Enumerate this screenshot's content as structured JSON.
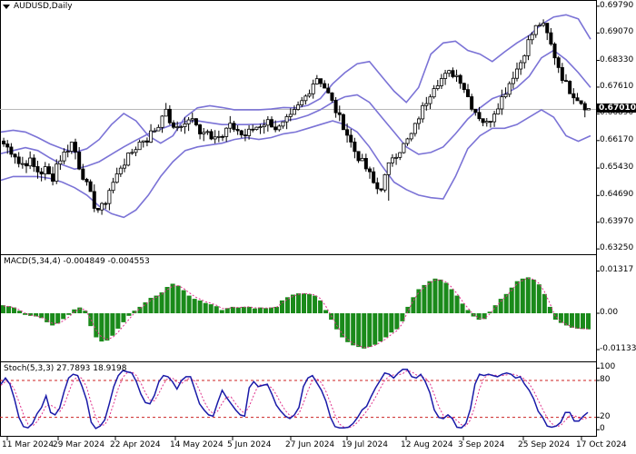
{
  "chart_data": [
    {
      "type": "candlestick",
      "title": "AUDUSD,Daily",
      "y_ticks": [
        "0.69790",
        "0.69070",
        "0.68330",
        "0.67610",
        "0.66890",
        "0.66170",
        "0.65430",
        "0.64690",
        "0.63970",
        "0.63250"
      ],
      "ylim": [
        0.6318,
        0.6986
      ],
      "current_price": 0.6701,
      "current_price_label": "0.67010",
      "x_ticks": [
        "11 Mar 2024",
        "29 Mar 2024",
        "22 Apr 2024",
        "14 May 2024",
        "5 Jun 2024",
        "27 Jun 2024",
        "19 Jul 2024",
        "12 Aug 2024",
        "3 Sep 2024",
        "25 Sep 2024",
        "17 Oct 2024"
      ],
      "overlay": "Bollinger Bands",
      "close_path": [
        0.6608,
        0.6594,
        0.6583,
        0.6551,
        0.6558,
        0.6561,
        0.6537,
        0.6531,
        0.6542,
        0.6506,
        0.6557,
        0.6575,
        0.6595,
        0.6616,
        0.6555,
        0.652,
        0.648,
        0.6444,
        0.6427,
        0.6448,
        0.649,
        0.6513,
        0.6548,
        0.6563,
        0.6584,
        0.6602,
        0.662,
        0.6621,
        0.6644,
        0.6651,
        0.6703,
        0.668,
        0.6641,
        0.6662,
        0.6658,
        0.668,
        0.6659,
        0.6642,
        0.6648,
        0.6631,
        0.664,
        0.6618,
        0.6651,
        0.6654,
        0.6645,
        0.6627,
        0.6638,
        0.665,
        0.6658,
        0.6665,
        0.6669,
        0.6652,
        0.6649,
        0.6668,
        0.6678,
        0.67,
        0.672,
        0.674,
        0.677,
        0.6789,
        0.677,
        0.6742,
        0.6712,
        0.668,
        0.6655,
        0.662,
        0.6589,
        0.6566,
        0.6545,
        0.652,
        0.6486,
        0.6493,
        0.653,
        0.6575,
        0.6585,
        0.66,
        0.6618,
        0.664,
        0.668,
        0.671,
        0.674,
        0.677,
        0.678,
        0.679,
        0.68,
        0.6795,
        0.678,
        0.6745,
        0.6712,
        0.669,
        0.6672,
        0.666,
        0.669,
        0.6715,
        0.674,
        0.677,
        0.68,
        0.682,
        0.686,
        0.6895,
        0.692,
        0.6935,
        0.691,
        0.687,
        0.683,
        0.679,
        0.676,
        0.6745,
        0.673,
        0.6715,
        0.6701
      ],
      "bollinger_upper": [
        0.664,
        0.6645,
        0.664,
        0.6625,
        0.6608,
        0.6595,
        0.6585,
        0.6595,
        0.662,
        0.666,
        0.669,
        0.667,
        0.663,
        0.661,
        0.663,
        0.668,
        0.6705,
        0.6711,
        0.6706,
        0.67,
        0.67,
        0.67,
        0.6702,
        0.6706,
        0.6705,
        0.6712,
        0.673,
        0.677,
        0.68,
        0.6824,
        0.683,
        0.679,
        0.675,
        0.672,
        0.676,
        0.685,
        0.688,
        0.6885,
        0.686,
        0.685,
        0.683,
        0.6856,
        0.688,
        0.69,
        0.693,
        0.695,
        0.6956,
        0.6945,
        0.689
      ],
      "bollinger_mid": [
        0.6582,
        0.659,
        0.6598,
        0.659,
        0.657,
        0.6552,
        0.654,
        0.6548,
        0.656,
        0.658,
        0.66,
        0.6618,
        0.6635,
        0.6648,
        0.666,
        0.6668,
        0.667,
        0.6665,
        0.666,
        0.666,
        0.666,
        0.6661,
        0.6665,
        0.667,
        0.6675,
        0.6685,
        0.67,
        0.672,
        0.6735,
        0.674,
        0.672,
        0.668,
        0.664,
        0.66,
        0.658,
        0.6585,
        0.66,
        0.6635,
        0.6675,
        0.6705,
        0.673,
        0.6742,
        0.676,
        0.679,
        0.684,
        0.686,
        0.6835,
        0.68,
        0.676
      ],
      "bollinger_lower": [
        0.651,
        0.652,
        0.652,
        0.652,
        0.6515,
        0.6505,
        0.649,
        0.647,
        0.644,
        0.642,
        0.641,
        0.643,
        0.647,
        0.652,
        0.656,
        0.659,
        0.66,
        0.6605,
        0.661,
        0.662,
        0.6625,
        0.662,
        0.6625,
        0.6635,
        0.664,
        0.665,
        0.666,
        0.667,
        0.666,
        0.664,
        0.66,
        0.655,
        0.6505,
        0.6485,
        0.647,
        0.6463,
        0.646,
        0.652,
        0.6595,
        0.663,
        0.665,
        0.665,
        0.666,
        0.668,
        0.67,
        0.668,
        0.663,
        0.6615,
        0.663
      ]
    },
    {
      "type": "bar",
      "title": "MACD(5,34,4) -0.004849 -0.004553",
      "y_ticks": [
        "0.01317",
        "0.00",
        "-0.01133"
      ],
      "ylim": [
        -0.0133,
        0.015
      ],
      "histogram": [
        0.0025,
        0.0022,
        0.0018,
        0.0008,
        -0.0005,
        -0.0008,
        -0.001,
        -0.0015,
        -0.0028,
        -0.0038,
        -0.0032,
        -0.0018,
        -0.0005,
        0.0012,
        0.0018,
        0.0008,
        -0.004,
        -0.0075,
        -0.0088,
        -0.0085,
        -0.007,
        -0.0048,
        -0.0028,
        -0.0008,
        0.0008,
        0.002,
        0.0034,
        0.0048,
        0.0055,
        0.0065,
        0.0082,
        0.0092,
        0.0086,
        0.0072,
        0.0055,
        0.0045,
        0.004,
        0.0032,
        0.0028,
        0.0022,
        0.001,
        0.0016,
        0.002,
        0.0018,
        0.002,
        0.002,
        0.0015,
        0.0018,
        0.0016,
        0.0018,
        0.002,
        0.004,
        0.005,
        0.0058,
        0.0062,
        0.0062,
        0.006,
        0.0055,
        0.004,
        0.001,
        -0.002,
        -0.005,
        -0.0075,
        -0.009,
        -0.01,
        -0.0105,
        -0.011,
        -0.0105,
        -0.0098,
        -0.0088,
        -0.0075,
        -0.006,
        -0.005,
        -0.0025,
        0.002,
        0.005,
        0.0075,
        0.0088,
        0.01,
        0.0108,
        0.0105,
        0.0095,
        0.0075,
        0.0055,
        0.003,
        0.001,
        -0.001,
        -0.002,
        -0.0018,
        0.0005,
        0.0025,
        0.0045,
        0.006,
        0.008,
        0.01,
        0.0108,
        0.0112,
        0.0105,
        0.009,
        0.006,
        0.002,
        -0.002,
        -0.003,
        -0.0038,
        -0.0045,
        -0.0048,
        -0.0049,
        -0.005
      ],
      "signal": [
        0.0023,
        0.0021,
        0.0017,
        0.001,
        0.0,
        -0.0006,
        -0.0009,
        -0.0013,
        -0.0022,
        -0.0032,
        -0.0032,
        -0.0023,
        -0.0011,
        0.0005,
        0.0014,
        0.0011,
        -0.002,
        -0.0055,
        -0.0075,
        -0.0081,
        -0.0075,
        -0.0058,
        -0.0038,
        -0.0018,
        0.0002,
        0.0015,
        0.0028,
        0.0041,
        0.005,
        0.006,
        0.0074,
        0.0085,
        0.0086,
        0.0077,
        0.0064,
        0.0052,
        0.0044,
        0.0036,
        0.0031,
        0.0025,
        0.0015,
        0.0015,
        0.0018,
        0.0018,
        0.0019,
        0.002,
        0.0017,
        0.0017,
        0.0016,
        0.0017,
        0.0019,
        0.0032,
        0.0044,
        0.0053,
        0.0059,
        0.0061,
        0.006,
        0.0057,
        0.0046,
        0.0022,
        -0.0008,
        -0.0038,
        -0.0063,
        -0.0081,
        -0.0094,
        -0.0101,
        -0.0107,
        -0.0105,
        -0.01,
        -0.0091,
        -0.008,
        -0.0066,
        -0.0055,
        -0.0033,
        0.0005,
        0.0038,
        0.0064,
        0.008,
        0.0094,
        0.0103,
        0.0104,
        0.0098,
        0.0082,
        0.0062,
        0.0038,
        0.0017,
        -0.0003,
        -0.0015,
        -0.0017,
        -0.0003,
        0.0017,
        0.0036,
        0.0052,
        0.0071,
        0.0091,
        0.0102,
        0.0109,
        0.0106,
        0.0094,
        0.0069,
        0.0033,
        -0.0008,
        -0.0024,
        -0.0034,
        -0.0042,
        -0.0046,
        -0.0048,
        -0.0049
      ]
    },
    {
      "type": "line",
      "title": "Stoch(5,3,3) 27.7893 18.9198",
      "y_ticks": [
        "100",
        "80",
        "20",
        "0"
      ],
      "ylim": [
        -10,
        108
      ],
      "levels": [
        80,
        20
      ],
      "k_line": [
        74,
        84,
        74,
        50,
        20,
        5,
        3,
        10,
        26,
        36,
        55,
        28,
        24,
        35,
        62,
        84,
        90,
        88,
        70,
        48,
        12,
        2,
        6,
        16,
        42,
        70,
        88,
        96,
        94,
        92,
        78,
        58,
        44,
        42,
        56,
        78,
        88,
        86,
        78,
        66,
        80,
        86,
        86,
        64,
        42,
        32,
        24,
        22,
        44,
        64,
        52,
        42,
        32,
        24,
        22,
        68,
        78,
        70,
        72,
        74,
        58,
        40,
        30,
        22,
        18,
        24,
        36,
        70,
        84,
        88,
        76,
        64,
        46,
        20,
        5,
        3,
        3,
        4,
        10,
        20,
        32,
        38,
        54,
        68,
        80,
        92,
        90,
        84,
        92,
        98,
        98,
        86,
        84,
        90,
        78,
        60,
        32,
        20,
        18,
        24,
        18,
        4,
        3,
        10,
        34,
        74,
        90,
        88,
        90,
        88,
        86,
        90,
        92,
        90,
        84,
        86,
        74,
        64,
        50,
        30,
        20,
        6,
        4,
        6,
        12,
        28,
        28,
        14,
        14,
        22,
        28
      ],
      "d_line": [
        72,
        78,
        77,
        65,
        45,
        25,
        9,
        6,
        13,
        24,
        39,
        40,
        36,
        29,
        40,
        60,
        79,
        87,
        83,
        69,
        43,
        21,
        7,
        8,
        21,
        43,
        67,
        85,
        93,
        94,
        88,
        76,
        60,
        48,
        47,
        59,
        74,
        84,
        84,
        77,
        75,
        81,
        84,
        79,
        64,
        46,
        33,
        26,
        30,
        43,
        53,
        53,
        42,
        33,
        26,
        38,
        56,
        72,
        73,
        72,
        68,
        57,
        43,
        31,
        23,
        21,
        26,
        43,
        63,
        81,
        83,
        76,
        62,
        43,
        24,
        9,
        4,
        3,
        6,
        12,
        21,
        30,
        41,
        53,
        67,
        80,
        87,
        89,
        89,
        91,
        96,
        94,
        89,
        87,
        84,
        76,
        57,
        37,
        23,
        21,
        20,
        15,
        8,
        6,
        16,
        39,
        66,
        84,
        89,
        89,
        88,
        88,
        89,
        91,
        89,
        87,
        82,
        75,
        63,
        48,
        33,
        19,
        10,
        5,
        7,
        15,
        23,
        23,
        19,
        17,
        19
      ]
    }
  ]
}
